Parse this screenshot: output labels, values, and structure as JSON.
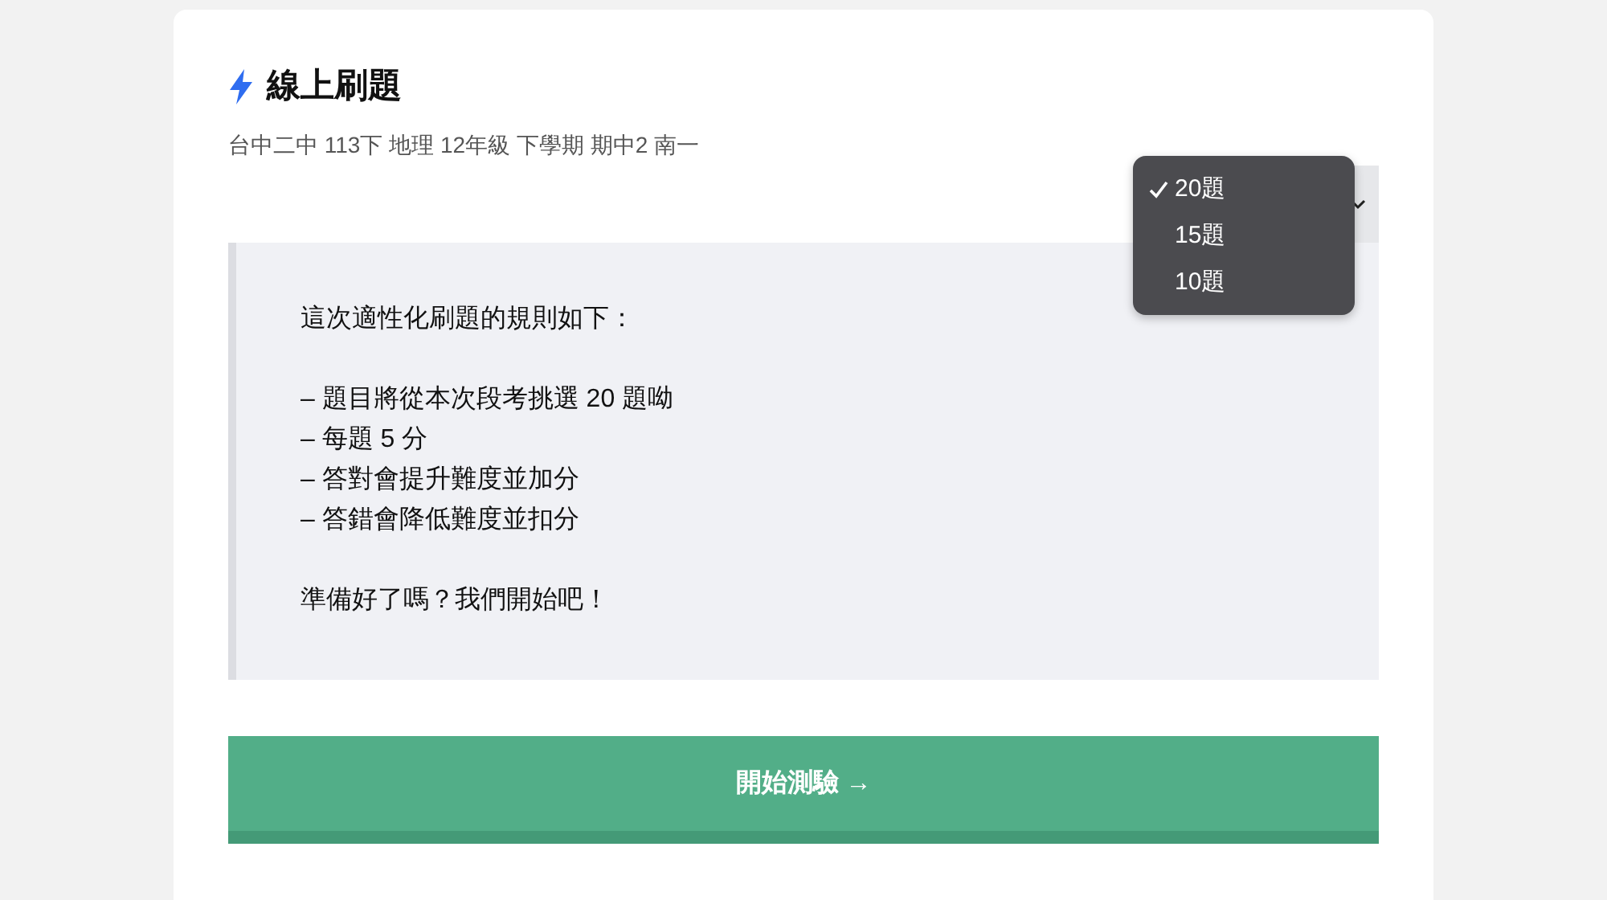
{
  "header": {
    "title": "線上刷題",
    "subtitle": "台中二中 113下 地理 12年級 下學期 期中2 南一"
  },
  "count_select": {
    "options": [
      {
        "label": "20題",
        "selected": true
      },
      {
        "label": "15題",
        "selected": false
      },
      {
        "label": "10題",
        "selected": false
      }
    ]
  },
  "rules": {
    "intro": "這次適性化刷題的規則如下：",
    "items": [
      "– 題目將從本次段考挑選 20 題呦",
      "– 每題 5 分",
      "– 答對會提升難度並加分",
      "– 答錯會降低難度並扣分"
    ],
    "closing": "準備好了嗎？我們開始吧！"
  },
  "start_button": {
    "label": "開始測驗 →"
  }
}
